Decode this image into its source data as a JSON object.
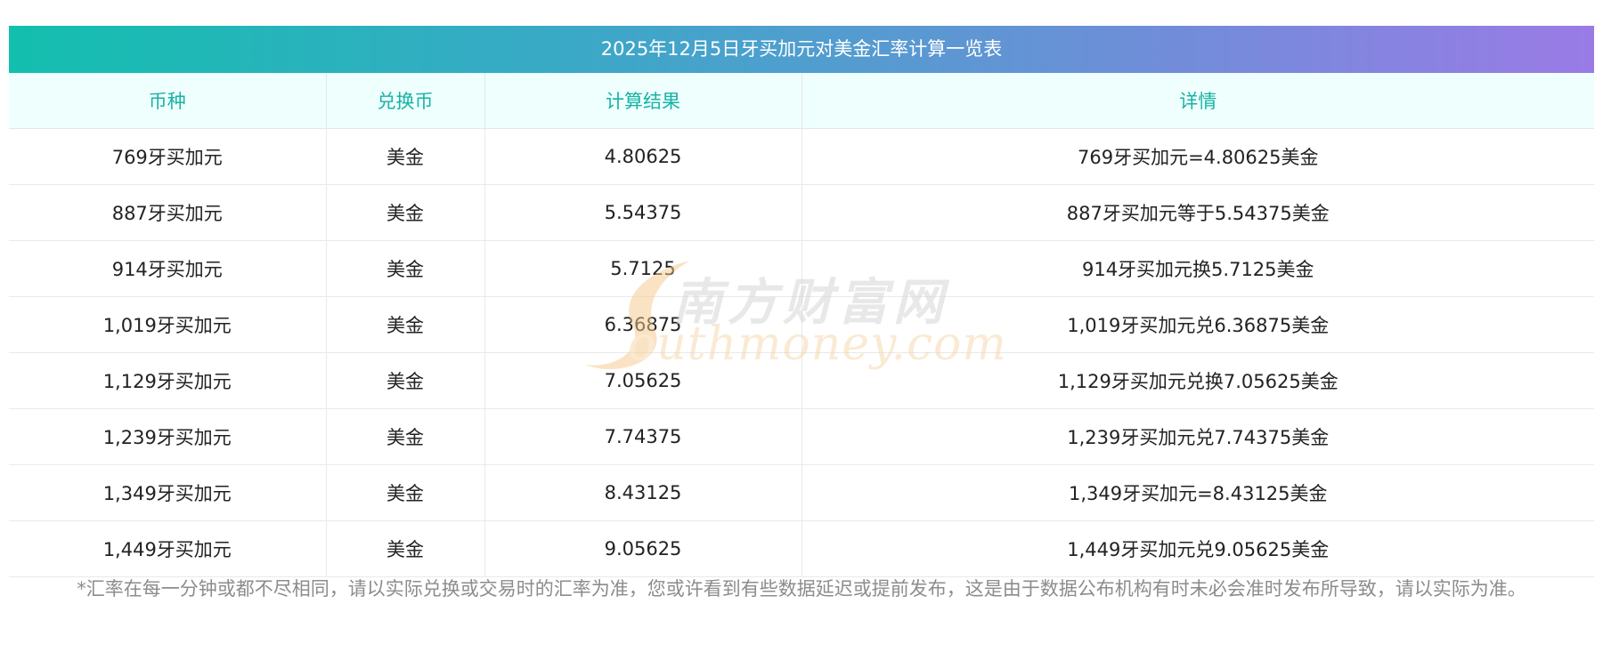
{
  "table_title": "2025年12月5日牙买加元对美金汇率计算一览表",
  "headers": [
    "币种",
    "兑换币",
    "计算结果",
    "详情"
  ],
  "rows": [
    {
      "currency": "769牙买加元",
      "target": "美金",
      "result": "4.80625",
      "detail": "769牙买加元=4.80625美金"
    },
    {
      "currency": "887牙买加元",
      "target": "美金",
      "result": "5.54375",
      "detail": "887牙买加元等于5.54375美金"
    },
    {
      "currency": "914牙买加元",
      "target": "美金",
      "result": "5.7125",
      "detail": "914牙买加元换5.7125美金"
    },
    {
      "currency": "1,019牙买加元",
      "target": "美金",
      "result": "6.36875",
      "detail": "1,019牙买加元兑6.36875美金"
    },
    {
      "currency": "1,129牙买加元",
      "target": "美金",
      "result": "7.05625",
      "detail": "1,129牙买加元兑换7.05625美金"
    },
    {
      "currency": "1,239牙买加元",
      "target": "美金",
      "result": "7.74375",
      "detail": "1,239牙买加元兑7.74375美金"
    },
    {
      "currency": "1,349牙买加元",
      "target": "美金",
      "result": "8.43125",
      "detail": "1,349牙买加元=8.43125美金"
    },
    {
      "currency": "1,449牙买加元",
      "target": "美金",
      "result": "9.05625",
      "detail": "1,449牙买加元兑9.05625美金"
    }
  ],
  "footnote": "*汇率在每一分钟或都不尽相同，请以实际兑换或交易时的汇率为准，您或许看到有些数据延迟或提前发布，这是由于数据公布机构有时未必会准时发布所导致，请以实际为准。",
  "watermark": {
    "cn": "南方财富网",
    "en": "outhmoney.com"
  },
  "colors": {
    "title_gradient_start": "#13bfae",
    "title_gradient_end": "#9a7be6",
    "header_bg": "#effffd",
    "header_text": "#16b3a6",
    "note_text": "#8c8c8c"
  }
}
